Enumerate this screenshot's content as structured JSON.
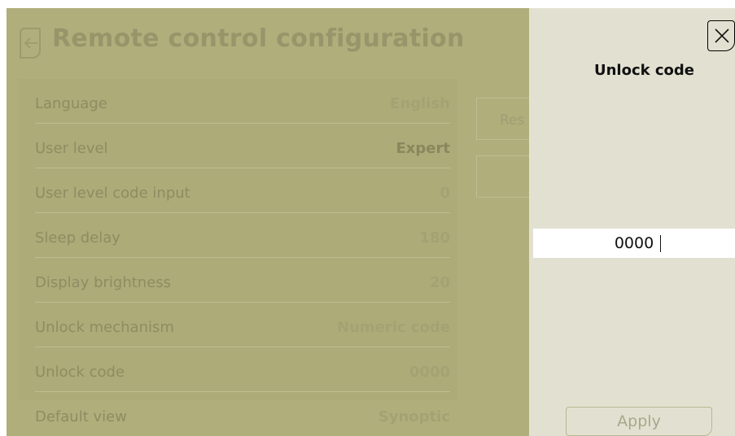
{
  "header": {
    "title": "Remote control configuration"
  },
  "settings": [
    {
      "label": "Language",
      "value": "English"
    },
    {
      "label": "User level",
      "value": "Expert"
    },
    {
      "label": "User level code input",
      "value": "0"
    },
    {
      "label": "Sleep delay",
      "value": "180"
    },
    {
      "label": "Display brightness",
      "value": "20"
    },
    {
      "label": "Unlock mechanism",
      "value": "Numeric code"
    },
    {
      "label": "Unlock code",
      "value": "0000"
    },
    {
      "label": "Default view",
      "value": "Synoptic"
    }
  ],
  "side_buttons": {
    "reset_partial": "Res"
  },
  "panel": {
    "title": "Unlock code",
    "code_value": "0000",
    "apply_label": "Apply"
  },
  "icons": {
    "back": "back-arrow-icon",
    "close": "close-icon"
  },
  "colors": {
    "overlay": "#b0ae7b",
    "panel_bg": "#e2e1d1",
    "input_bg": "#ffffff"
  }
}
